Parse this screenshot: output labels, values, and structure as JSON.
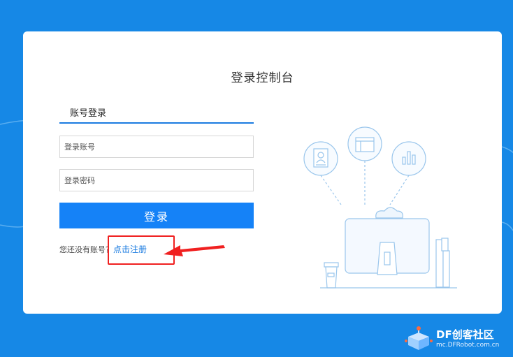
{
  "login": {
    "title": "登录控制台",
    "tab_label": "账号登录",
    "account_placeholder": "登录账号",
    "password_placeholder": "登录密码",
    "submit_label": "登录",
    "register_prompt": "您还没有账号？",
    "register_link": "点击注册"
  },
  "watermark": {
    "name": "DF创客社区",
    "url": "mc.DFRobot.com.cn"
  },
  "colors": {
    "background": "#1688e6",
    "primary": "#1582f7",
    "annotation": "#f02020"
  }
}
